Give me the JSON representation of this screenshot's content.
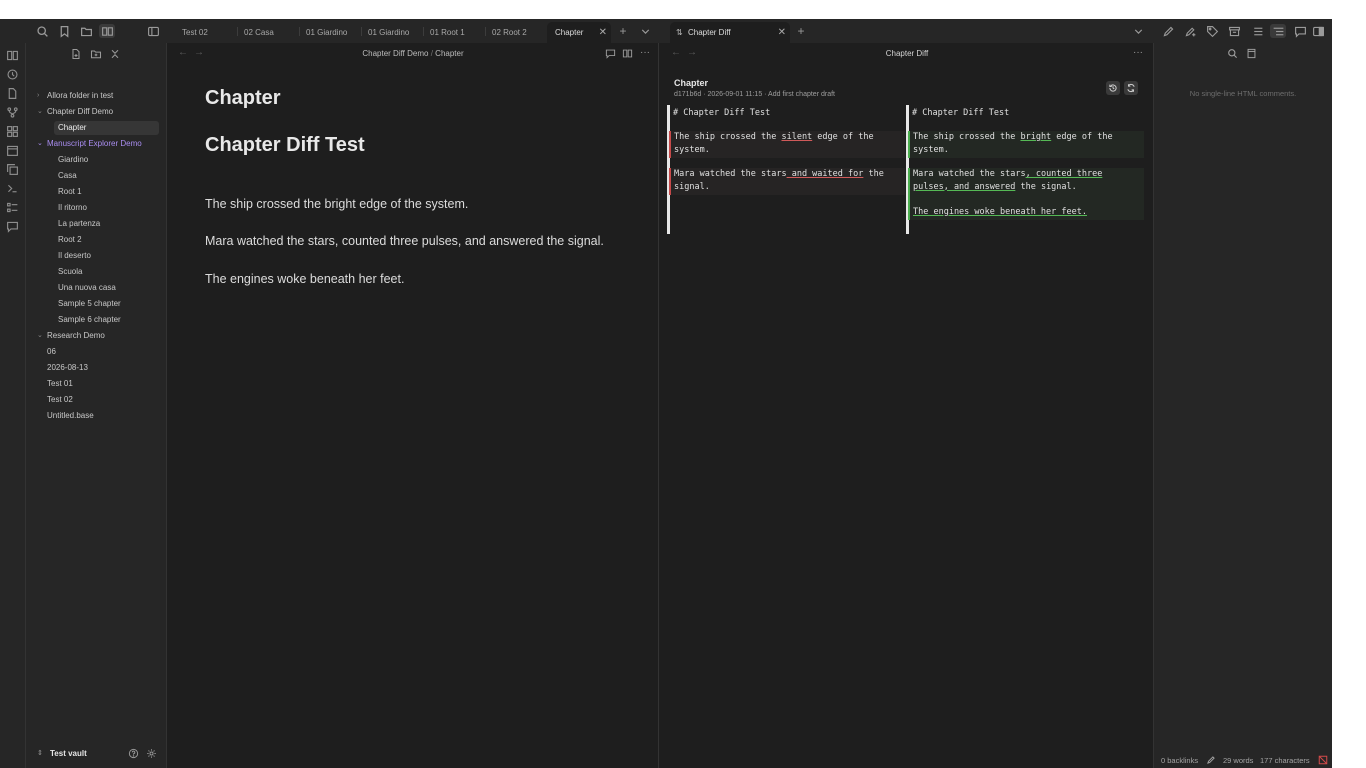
{
  "tabs": [
    {
      "label": "Test 02"
    },
    {
      "label": "02 Casa"
    },
    {
      "label": "01 Giardino"
    },
    {
      "label": "01 Giardino"
    },
    {
      "label": "01 Root 1"
    },
    {
      "label": "02 Root 2"
    },
    {
      "label": "Chapter",
      "active": true
    }
  ],
  "diff_tab": {
    "label": "Chapter Diff"
  },
  "explorer": {
    "items": [
      {
        "label": "Allora folder in test",
        "type": "folder",
        "state": "collapsed"
      },
      {
        "label": "Chapter Diff Demo",
        "type": "folder",
        "state": "expanded"
      },
      {
        "label": "Chapter",
        "type": "file",
        "selected": true
      },
      {
        "label": "Manuscript Explorer Demo",
        "type": "folder",
        "state": "expanded",
        "accent": true
      },
      {
        "label": "Giardino",
        "type": "file"
      },
      {
        "label": "Casa",
        "type": "file"
      },
      {
        "label": "Root 1",
        "type": "file"
      },
      {
        "label": "Il ritorno",
        "type": "file"
      },
      {
        "label": "La partenza",
        "type": "file"
      },
      {
        "label": "Root 2",
        "type": "file"
      },
      {
        "label": "Il deserto",
        "type": "file"
      },
      {
        "label": "Scuola",
        "type": "file"
      },
      {
        "label": "Una nuova casa",
        "type": "file"
      },
      {
        "label": "Sample 5 chapter",
        "type": "file"
      },
      {
        "label": "Sample 6 chapter",
        "type": "file"
      },
      {
        "label": "Research Demo",
        "type": "folder",
        "state": "expanded"
      },
      {
        "label": "06",
        "type": "file"
      },
      {
        "label": "2026-08-13",
        "type": "file"
      },
      {
        "label": "Test 01",
        "type": "file"
      },
      {
        "label": "Test 02",
        "type": "file"
      },
      {
        "label": "Untitled.base",
        "type": "file"
      }
    ],
    "vault_name": "Test vault"
  },
  "editor": {
    "breadcrumb_folder": "Chapter Diff Demo",
    "breadcrumb_sep": "/",
    "breadcrumb_file": "Chapter",
    "inline_title": "Chapter",
    "heading": "Chapter Diff Test",
    "paragraphs": [
      "The ship crossed the bright edge of the system.",
      "Mara watched the stars, counted three pulses, and answered the signal.",
      "The engines woke beneath her feet."
    ]
  },
  "diff": {
    "header_title": "Chapter Diff",
    "file_name": "Chapter",
    "commit_line": "d171b6d · 2026-09-01 11:15 · Add first chapter draft",
    "left": {
      "heading": "# Chapter Diff Test",
      "p1_a": "The ship crossed the ",
      "p1_rm": "silent",
      "p1_b": " edge of the",
      "p1_c": "system.",
      "p2_a": "Mara watched the stars",
      "p2_rm": " and waited for",
      "p2_b": " the",
      "p2_c": "signal."
    },
    "right": {
      "heading": "# Chapter Diff Test",
      "p1_a": "The ship crossed the ",
      "p1_add": "bright",
      "p1_b": " edge of the",
      "p1_c": "system.",
      "p2_a": "Mara watched the stars",
      "p2_add": ", counted three",
      "p2_add2": "pulses, and answered",
      "p2_b": " the signal.",
      "p3_add": "The engines woke beneath her feet."
    }
  },
  "right_sidebar": {
    "empty_text": "No single-line HTML comments.",
    "status": {
      "backlinks": "0 backlinks",
      "words": "29 words",
      "characters": "177 characters"
    }
  },
  "colors": {
    "accent": "#a98df0",
    "removed": "#c74a4a",
    "added": "#4caf50",
    "background": "#1e1e1e",
    "sidebar": "#262626"
  }
}
